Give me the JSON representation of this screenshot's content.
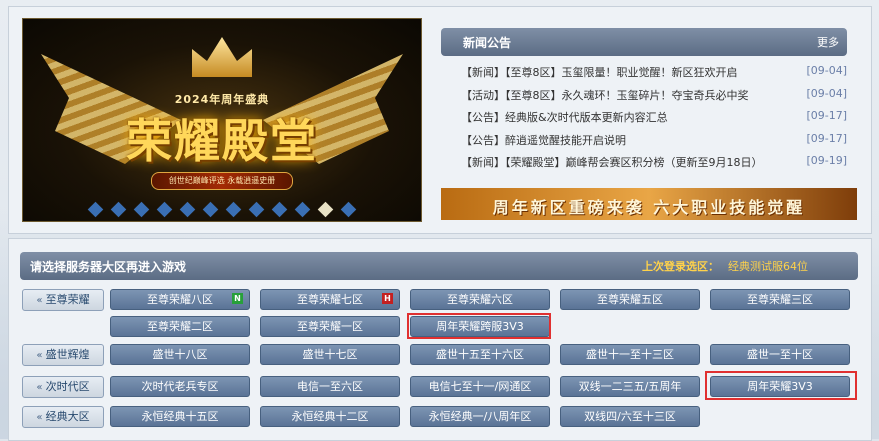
{
  "banner": {
    "subtitle": "2024年周年盛典",
    "title": "荣耀殿堂",
    "slogan": "创世纪巅峰评选 永载逍遥史册",
    "slides": 12,
    "active_slide": 11
  },
  "news": {
    "title": "新闻公告",
    "more": "更多",
    "items": [
      {
        "text": "【新闻】【至尊8区】玉玺限量！职业觉醒！新区狂欢开启",
        "date": "[09-04]"
      },
      {
        "text": "【活动】【至尊8区】永久魂环！玉玺碎片！夺宝奇兵必中奖",
        "date": "[09-04]"
      },
      {
        "text": "【公告】经典版&次时代版本更新内容汇总",
        "date": "[09-17]"
      },
      {
        "text": "【公告】醉逍遥觉醒技能开启说明",
        "date": "[09-17]"
      },
      {
        "text": "【新闻】【荣耀殿堂】巅峰帮会赛区积分榜（更新至9月18日）",
        "date": "[09-19]"
      }
    ]
  },
  "promo": {
    "text": "周年新区重磅来袭 六大职业技能觉醒"
  },
  "servers": {
    "title": "请选择服务器大区再进入游戏",
    "last_label": "上次登录选区：",
    "last_value": "经典测试服64位",
    "categories": [
      {
        "label": "至尊荣耀"
      },
      {
        "label": "盛世辉煌"
      },
      {
        "label": "次时代区"
      },
      {
        "label": "经典大区"
      }
    ],
    "rows": {
      "zz1": [
        "至尊荣耀八区",
        "至尊荣耀七区",
        "至尊荣耀六区",
        "至尊荣耀五区",
        "至尊荣耀三区"
      ],
      "zz2": [
        "至尊荣耀二区",
        "至尊荣耀一区",
        "周年荣耀跨服3V3"
      ],
      "ss": [
        "盛世十八区",
        "盛世十七区",
        "盛世十五至十六区",
        "盛世十一至十三区",
        "盛世一至十区"
      ],
      "csd": [
        "次时代老兵专区",
        "电信一至六区",
        "电信七至十一/网通区",
        "双线一二三五/五周年",
        "周年荣耀3V3"
      ],
      "jd": [
        "永恒经典十五区",
        "永恒经典十二区",
        "永恒经典一/八周年区",
        "双线四/六至十三区"
      ]
    },
    "badges": {
      "new": "N",
      "hot": "H"
    }
  }
}
